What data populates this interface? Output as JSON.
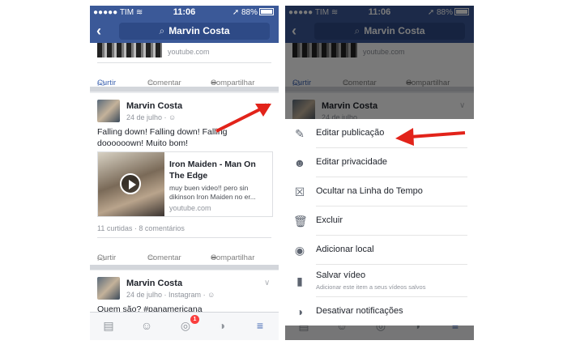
{
  "status": {
    "carrier": "TIM",
    "time": "11:06",
    "battery": "88%"
  },
  "nav": {
    "search_text": "Marvin Costa"
  },
  "feed": {
    "top_link_source": "youtube.com",
    "actions": {
      "like": "Curtir",
      "comment": "Comentar",
      "share": "Compartilhar"
    },
    "post1": {
      "author": "Marvin Costa",
      "date": "24 de julho",
      "text": "Falling down! Falling down! Falling doooooown! Muito bom!",
      "link_title": "Iron Maiden - Man On The Edge",
      "link_desc": "muy buen video!! pero sin dikinson Iron Maiden no er...",
      "link_source": "youtube.com",
      "stats": "11 curtidas · 8 comentários"
    },
    "post2": {
      "author": "Marvin Costa",
      "date": "24 de julho · Instagram",
      "text": "Quem são? #panamericana"
    }
  },
  "tabbar": {
    "badge": "1"
  },
  "menu": {
    "items": [
      {
        "label": "Editar publicação",
        "icon": "pencil-icon"
      },
      {
        "label": "Editar privacidade",
        "icon": "people-icon"
      },
      {
        "label": "Ocultar na Linha do Tempo",
        "icon": "hide-x-icon"
      },
      {
        "label": "Excluir",
        "icon": "trash-icon"
      },
      {
        "label": "Adicionar local",
        "icon": "location-pin-icon"
      },
      {
        "label": "Salvar vídeo",
        "sublabel": "Adicionar este item a seus vídeos salvos",
        "icon": "bookmark-icon"
      },
      {
        "label": "Desativar notificações",
        "icon": "globe-icon"
      }
    ]
  },
  "colors": {
    "facebook_blue": "#3b5998",
    "arrow_red": "#e2231a"
  }
}
